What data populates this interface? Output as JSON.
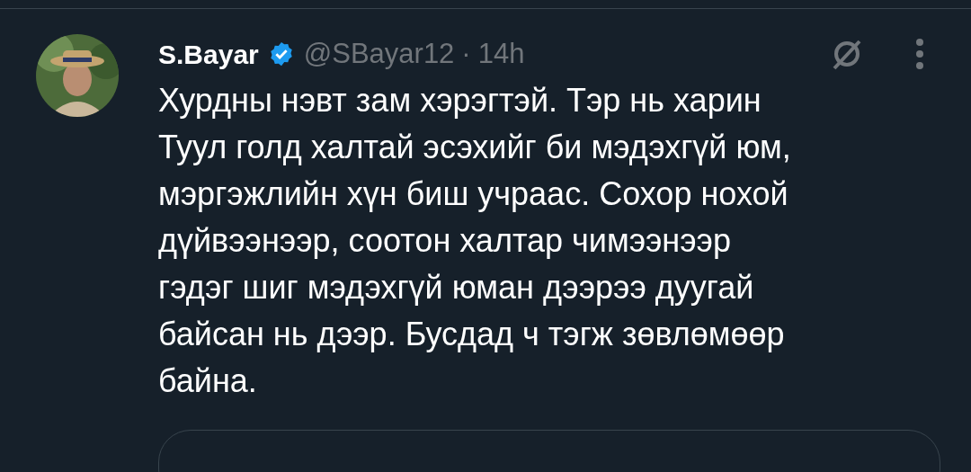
{
  "tweet": {
    "name": "S.Bayar",
    "verified": true,
    "handle": "@SBayar12",
    "separator": "·",
    "time": "14h",
    "text_lines": [
      "Хурдны нэвт зам хэрэгтэй. Тэр нь харин",
      "Туул голд халтай эсэхийг би мэдэхгүй юм,",
      "мэргэжлийн хүн биш учраас. Сохор нохой",
      "дүйвээнээр, соотон халтар чимээнээр",
      "гэдэг шиг мэдэхгүй юман дээрээ дуугай",
      "байсан нь дээр. Бусдад ч тэгж зөвлөмөөр",
      "байна."
    ]
  }
}
